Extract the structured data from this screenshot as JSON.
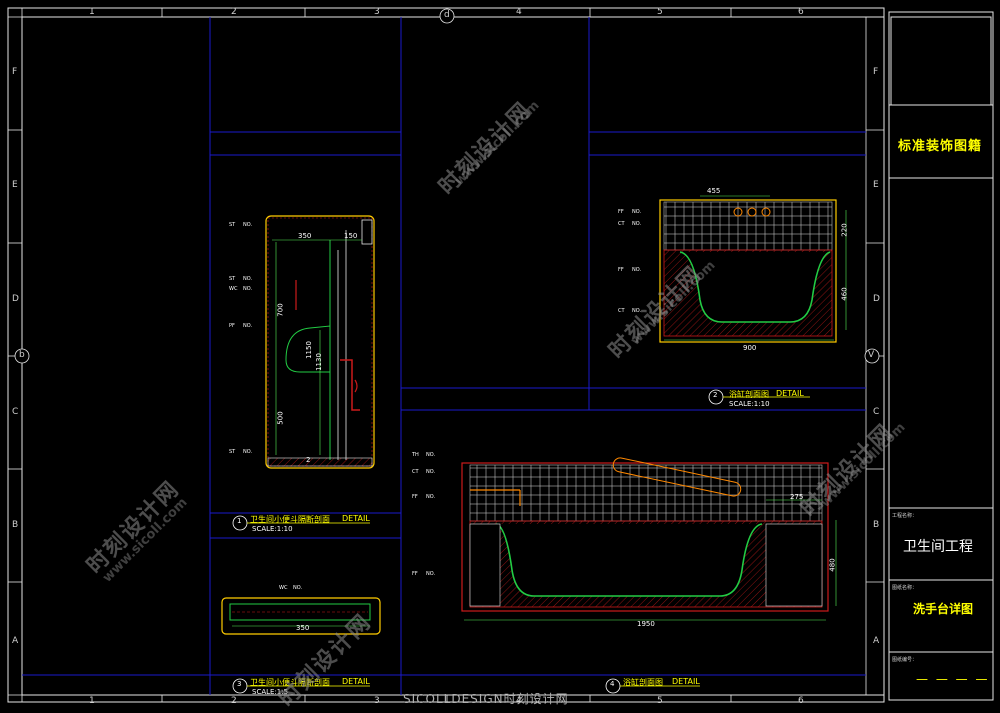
{
  "grid": {
    "columns": [
      "1",
      "2",
      "3",
      "4",
      "5",
      "6"
    ],
    "rows": [
      "F",
      "E",
      "D",
      "C",
      "B",
      "A"
    ],
    "axis_labels": {
      "top": "d",
      "left": "b",
      "right": "V"
    }
  },
  "title_block": {
    "title": "标准装饰图籍",
    "project_label": "工程名称：",
    "project": "卫生间工程",
    "drawing_label": "图纸名称：",
    "drawing": "洗手台详图",
    "number_label": "图纸编号：",
    "number": "— — — —"
  },
  "details": [
    {
      "num": "1",
      "title": "卫生间小便斗隔断剖面",
      "tag": "DETAIL",
      "scale": "SCALE:1:10"
    },
    {
      "num": "2",
      "title": "浴缸剖面图",
      "tag": "DETAIL",
      "scale": "SCALE:1:10"
    },
    {
      "num": "3",
      "title": "卫生间小便斗隔断剖面",
      "tag": "DETAIL",
      "scale": "SCALE:1:5"
    },
    {
      "num": "4",
      "title": "浴缸剖面图",
      "tag": "DETAIL",
      "scale": "SCALE:1:10"
    }
  ],
  "dimensions": {
    "urinal": [
      "350",
      "150",
      "700",
      "1150",
      "1130",
      "500",
      "2"
    ],
    "plan": [
      "350"
    ],
    "tub_small": [
      "455",
      "220",
      "460",
      "900"
    ],
    "tub_large": [
      "275",
      "480",
      "1950"
    ]
  },
  "tags": {
    "urinal": [
      "ST",
      "NO.",
      "ST",
      "NO.",
      "WC",
      "NO.",
      "PF",
      "NO.",
      "ST",
      "NO."
    ],
    "plan": [
      "WC",
      "NO."
    ],
    "tub_small": [
      "FF",
      "NO.",
      "CT",
      "NO.",
      "FF",
      "NO.",
      "CT",
      "NO."
    ],
    "tub_large": [
      "TH",
      "NO.",
      "CT",
      "NO.",
      "FF",
      "NO.",
      "FF",
      "NO."
    ]
  },
  "watermark": {
    "cn": "时刻设计网",
    "en": "www.sicoll.com"
  },
  "footer": "SICOLLDESIGN时刻设计网",
  "colors": {
    "border": "#e6e6e6",
    "panel": "#1a1acc",
    "wall": "#cc1a1a",
    "tub": "#22cc44",
    "hatch": "#e6e6e6",
    "title": "#ffff00",
    "dim": "#55ee55"
  }
}
